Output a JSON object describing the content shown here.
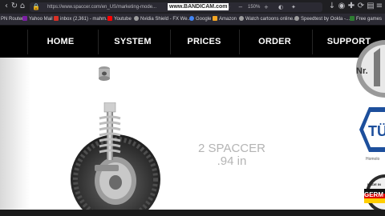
{
  "browser": {
    "url": "https://www.spaccer.com/en_US/marketing-mode...",
    "watermark": "www.BANDICAM.com",
    "zoom": "150%",
    "icons": {
      "back": "back-arrow-icon",
      "forward": "forward-arrow-icon",
      "reload": "reload-icon",
      "home": "home-icon",
      "lock": "lock-icon",
      "bookmark_star": "star-icon",
      "zoom_out": "minus-icon",
      "zoom_in": "plus-icon",
      "extensions": "puzzle-icon",
      "menu": "menu-icon"
    },
    "bookmarks": [
      {
        "label": "PN Router",
        "color": "#5a5a60"
      },
      {
        "label": "Yahoo Mail",
        "color": "#7b1fa2"
      },
      {
        "label": "inbox (2,361) - mahm...",
        "color": "#d93025"
      },
      {
        "label": "Youtube",
        "color": "#ff0000"
      },
      {
        "label": "Nvidia Shield - FX We...",
        "color": "#9e9e9e"
      },
      {
        "label": "Google",
        "color": "#4285f4"
      },
      {
        "label": "Amazon",
        "color": "#f5a623"
      },
      {
        "label": "Watch cartoons online...",
        "color": "#9e9e9e"
      },
      {
        "label": "Speedtest by Ookla -...",
        "color": "#9e9e9e"
      },
      {
        "label": "Free games",
        "color": "#2e7d32"
      }
    ]
  },
  "site_nav": {
    "items": [
      "HOME",
      "SYSTEM",
      "PRICES",
      "ORDER",
      "SUPPORT"
    ]
  },
  "product": {
    "caption_line1": "2 SPACCER",
    "caption_line2": ".94 in"
  },
  "badges": {
    "nr1": "Nr.",
    "tuv": "TÜ",
    "homolog": "Homolo",
    "made_in": "MADE IN",
    "germany": "GERM"
  },
  "colors": {
    "nav_bg": "#000000",
    "nav_text": "#ffffff",
    "caption": "#b4b4b4",
    "tuv_blue": "#1d4f9c"
  }
}
